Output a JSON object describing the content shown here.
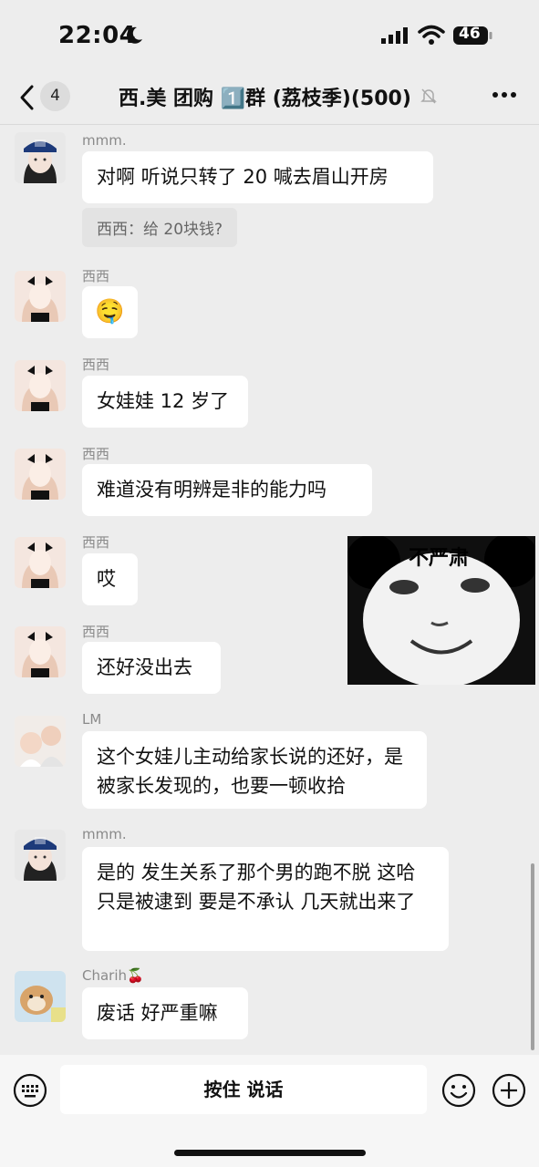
{
  "status": {
    "time": "22:04",
    "battery": "46"
  },
  "nav": {
    "unread_count": "4",
    "title": "西.美 团购 1️⃣群 (荔枝季)(500)"
  },
  "messages": [
    {
      "sender": "mmm.",
      "text": "对啊 听说只转了 20 喊去眉山开房",
      "quote": "西西：给 20块钱?"
    },
    {
      "sender": "西西",
      "text": "🤤"
    },
    {
      "sender": "西西",
      "text": "女娃娃 12 岁了"
    },
    {
      "sender": "西西",
      "text": "难道没有明辨是非的能力吗"
    },
    {
      "sender": "西西",
      "text": "哎"
    },
    {
      "sender": "西西",
      "text": "还好没出去"
    },
    {
      "sender": "LM",
      "text": "这个女娃儿主动给家长说的还好，是被家长发现的，也要一顿收拾"
    },
    {
      "sender": "mmm.",
      "text": "是的 发生关系了那个男的跑不脱 这哈只是被逮到 要是不承认 几天就出来了"
    },
    {
      "sender": "Charih🍒",
      "text": "废话 好严重嘛"
    }
  ],
  "sticker": {
    "caption": "不严肃"
  },
  "input": {
    "voice_label": "按住 说话"
  },
  "colors": {
    "background": "#ededed",
    "bubble": "#ffffff",
    "sender_text": "#8a8a8a"
  },
  "icons": [
    "moon-icon",
    "signal-icon",
    "wifi-icon",
    "battery-icon",
    "back-icon",
    "mute-bell-icon",
    "more-icon",
    "keyboard-icon",
    "emoji-icon",
    "plus-icon"
  ]
}
